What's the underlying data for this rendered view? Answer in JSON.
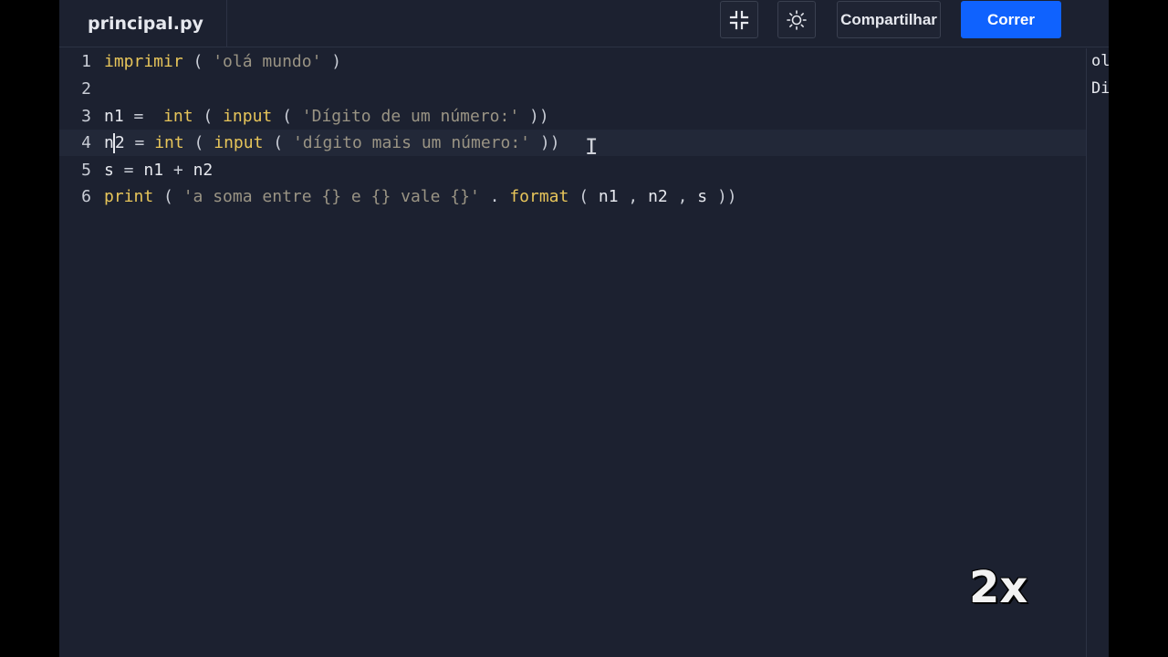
{
  "file_tab": {
    "name": "principal.py"
  },
  "toolbar": {
    "share_label": "Compartilhar",
    "run_label": "Correr"
  },
  "editor": {
    "lines": [
      {
        "number": "1",
        "segments": [
          [
            "kw",
            "imprimir"
          ],
          [
            "op",
            " ( "
          ],
          [
            "str",
            "'olá mundo'"
          ],
          [
            "op",
            " )"
          ]
        ]
      },
      {
        "number": "2",
        "segments": []
      },
      {
        "number": "3",
        "segments": [
          [
            "txt",
            "n1"
          ],
          [
            "op",
            " =  "
          ],
          [
            "kw",
            "int"
          ],
          [
            "op",
            " ( "
          ],
          [
            "kw",
            "input"
          ],
          [
            "op",
            " ( "
          ],
          [
            "str",
            "'Dígito de um número:'"
          ],
          [
            "op",
            " ))"
          ]
        ]
      },
      {
        "number": "4",
        "segments": [
          [
            "txt",
            "n2"
          ],
          [
            "op",
            " = "
          ],
          [
            "kw",
            "int"
          ],
          [
            "op",
            " ( "
          ],
          [
            "kw",
            "input"
          ],
          [
            "op",
            " ( "
          ],
          [
            "str",
            "'dígito mais um número:'"
          ],
          [
            "op",
            " ))"
          ]
        ]
      },
      {
        "number": "5",
        "segments": [
          [
            "txt",
            "s"
          ],
          [
            "op",
            " = "
          ],
          [
            "txt",
            "n1"
          ],
          [
            "op",
            " + "
          ],
          [
            "txt",
            "n2"
          ]
        ]
      },
      {
        "number": "6",
        "segments": [
          [
            "kw",
            "print"
          ],
          [
            "op",
            " ( "
          ],
          [
            "str",
            "'a soma entre {} e {} vale {}'"
          ],
          [
            "op",
            " . "
          ],
          [
            "kw",
            "format"
          ],
          [
            "op",
            " ( "
          ],
          [
            "txt",
            "n1"
          ],
          [
            "op",
            " , "
          ],
          [
            "txt",
            "n2"
          ],
          [
            "op",
            " , "
          ],
          [
            "txt",
            "s"
          ],
          [
            "op",
            " ))"
          ]
        ]
      }
    ],
    "active_line": 4
  },
  "output": {
    "lines": [
      "ol",
      "Di"
    ]
  },
  "overlay": {
    "speed": "2x"
  },
  "icons": {
    "collapse": "collapse-icon",
    "theme": "sun-icon"
  }
}
